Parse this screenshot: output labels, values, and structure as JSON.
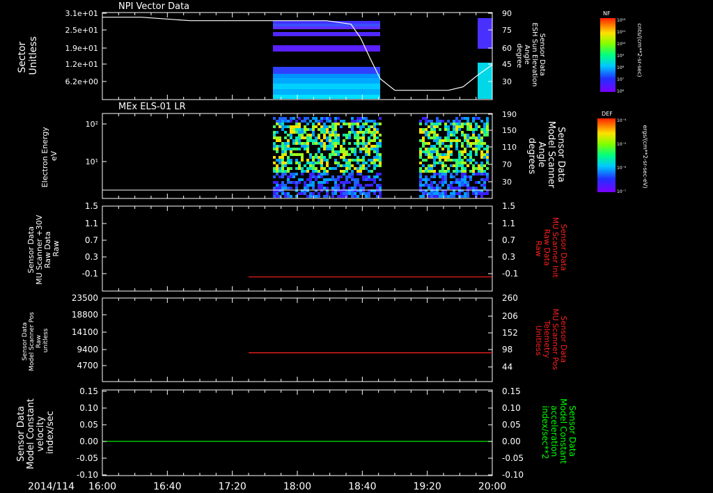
{
  "time_axis": {
    "date_label": "2014/114",
    "ticks": [
      "16:00",
      "16:40",
      "17:20",
      "18:00",
      "18:40",
      "19:20",
      "20:00"
    ],
    "start_hours": 16.0,
    "end_hours": 20.0
  },
  "colors": {
    "background": "#000000",
    "axis": "#ffffff",
    "red_trace": "#ff2020",
    "green_trace": "#00ff00"
  },
  "chart_data": [
    {
      "type": "heatmap",
      "title": "NPI Vector Data",
      "ylabel_lines": [
        "Sector",
        "Unitless"
      ],
      "yticks": [
        "3.1e+01",
        "2.5e+01",
        "1.9e+01",
        "1.2e+01",
        "6.2e+00"
      ],
      "y2label_lines": [
        "Sensor Data",
        "ESH Sun Elevation",
        "Angle",
        "degree"
      ],
      "y2ticks": [
        "90",
        "75",
        "60",
        "45",
        "30"
      ],
      "overlay_line": {
        "name": "ESH Sun Elevation Angle",
        "x_hours": [
          16.0,
          16.4,
          16.9,
          17.5,
          18.0,
          18.3,
          18.55,
          18.65,
          18.75,
          18.85,
          19.0,
          19.3,
          19.55,
          19.7,
          19.85,
          20.0
        ],
        "y_deg": [
          86,
          86,
          83,
          83,
          83,
          83,
          80,
          68,
          50,
          33,
          23,
          23,
          23,
          26,
          36,
          45
        ]
      },
      "colorbar": {
        "label_top": "NF",
        "units": "cnts/(cm**2-sr-sec)",
        "tick_labels": [
          "10¹²",
          "10¹¹",
          "10¹⁰",
          "10⁹",
          "10⁸",
          "10⁷",
          "10⁶"
        ]
      }
    },
    {
      "type": "heatmap",
      "title": "MEx ELS-01 LR",
      "ylabel_lines": [
        "Electron Energy",
        "eV"
      ],
      "yticks": [
        "10²",
        "10¹"
      ],
      "y2label_lines": [
        "Sensor Data",
        "Model Scanner",
        "Angle",
        "degrees"
      ],
      "y2ticks": [
        "190",
        "150",
        "110",
        "70",
        "30"
      ],
      "colorbar": {
        "label_top": "DEF",
        "units": "ergs/(cm**2-sr-sec-eV)",
        "tick_labels": [
          "10⁻⁴",
          "10⁻⁵",
          "10⁻⁶",
          "10⁻⁷"
        ]
      }
    },
    {
      "type": "line",
      "ylabel_lines": [
        "Sensor Data",
        "MU Scanner +30V",
        "Raw Data",
        "Raw"
      ],
      "yticks": [
        "1.5",
        "1.1",
        "0.7",
        "0.3",
        "-0.1"
      ],
      "y2label_lines": [
        "Sensor Data",
        "MU Scanner Init",
        "Raw Data",
        "Raw"
      ],
      "y2ticks": [
        "1.5",
        "1.1",
        "0.7",
        "0.3",
        "-0.1"
      ],
      "ylim": [
        -0.3,
        1.5
      ],
      "series": [
        {
          "x_hours": [
            17.5,
            20.0
          ],
          "values": [
            0.0,
            0.0
          ]
        }
      ]
    },
    {
      "type": "line",
      "ylabel_lines": [
        "Sensor Data",
        "Model Scanner Pos",
        "Raw",
        "unitless"
      ],
      "yticks": [
        "23500",
        "18800",
        "14100",
        "9400",
        "4700"
      ],
      "y2label_lines": [
        "Sensor Data",
        "MU Scanner Pos",
        "Telemetry",
        "Unitless"
      ],
      "y2ticks": [
        "260",
        "206",
        "152",
        "98",
        "44"
      ],
      "ylim": [
        0,
        23500
      ],
      "series": [
        {
          "x_hours": [
            17.5,
            20.0
          ],
          "values": [
            8100,
            8100
          ]
        }
      ]
    },
    {
      "type": "line",
      "ylabel_lines": [
        "Sensor Data",
        "Model Constant",
        "velocity",
        "index/sec"
      ],
      "yticks": [
        "0.15",
        "0.10",
        "0.05",
        "0.00",
        "-0.05",
        "-0.10"
      ],
      "y2label_lines": [
        "Sensor Data",
        "Model Constant",
        "acceleration",
        "index/sec**2"
      ],
      "y2ticks": [
        "0.15",
        "0.10",
        "0.05",
        "0.00",
        "-0.05",
        "-0.10"
      ],
      "ylim": [
        -0.1,
        0.15
      ],
      "series": [
        {
          "x_hours": [
            16.0,
            20.0
          ],
          "values": [
            0.0,
            0.0
          ]
        }
      ]
    }
  ]
}
